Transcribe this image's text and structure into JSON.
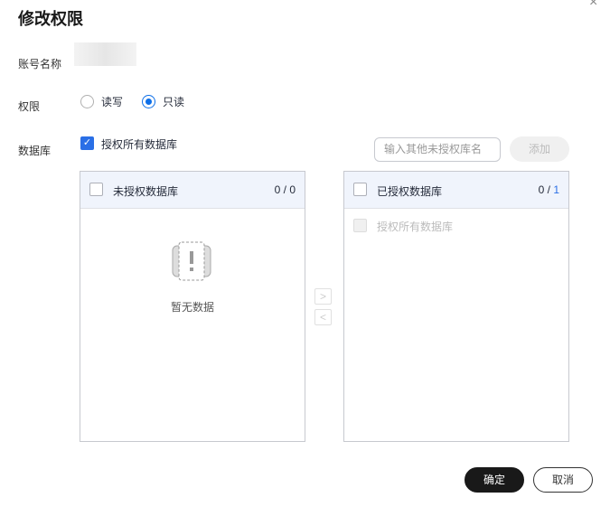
{
  "dialog": {
    "title": "修改权限",
    "close_icon": "×"
  },
  "form": {
    "account_label": "账号名称",
    "permission_label": "权限",
    "options": [
      "读写",
      "只读"
    ],
    "selected": "只读",
    "database_label": "数据库",
    "grant_all_label": "授权所有数据库",
    "input_placeholder": "输入其他未授权库名",
    "add_label": "添加"
  },
  "left_panel": {
    "title": "未授权数据库",
    "count": "0 / 0",
    "empty_text": "暂无数据"
  },
  "right_panel": {
    "title": "已授权数据库",
    "count_selected": "0",
    "count_total": "1",
    "items": [
      "授权所有数据库"
    ]
  },
  "footer": {
    "confirm": "确定",
    "cancel": "取消"
  }
}
